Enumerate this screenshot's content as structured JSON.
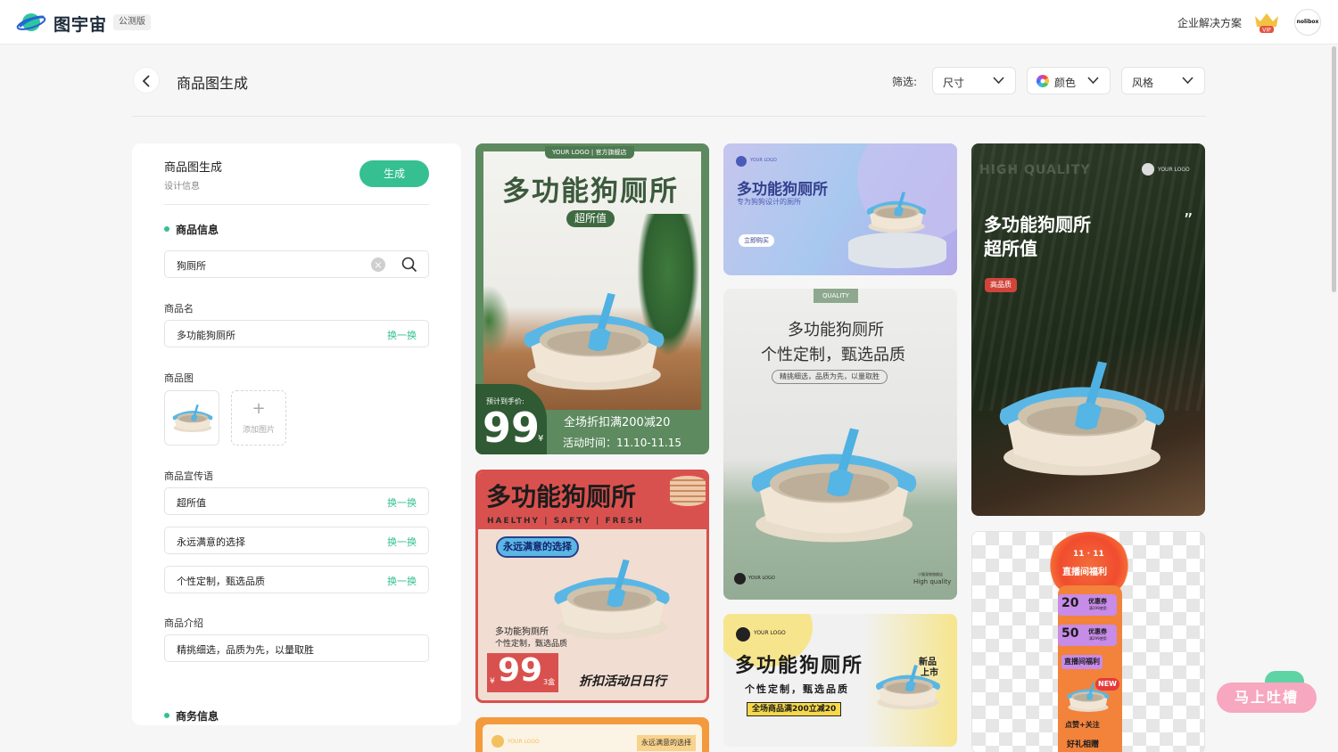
{
  "topbar": {
    "logo_text": "图宇宙",
    "beta_badge": "公测版",
    "enterprise_link": "企业解决方案",
    "vip_label": "VIP",
    "avatar_text": "nolibox"
  },
  "header": {
    "title": "商品图生成",
    "filter_label": "筛选:",
    "filters": [
      {
        "label": "尺寸"
      },
      {
        "label": "颜色"
      },
      {
        "label": "风格"
      }
    ]
  },
  "panel": {
    "title": "商品图生成",
    "subtitle": "设计信息",
    "generate_label": "生成",
    "product_info_heading": "商品信息",
    "search_value": "狗厕所",
    "name_label": "商品名",
    "name_value": "多功能狗厕所",
    "swap_label": "换一换",
    "image_label": "商品图",
    "add_image_label": "添加图片",
    "slogan_label": "商品宣传语",
    "slogans": [
      "超所值",
      "永远满意的选择",
      "个性定制，甄选品质"
    ],
    "intro_label": "商品介绍",
    "intro_value": "精挑细选，品质为先，以量取胜",
    "business_heading": "商务信息"
  },
  "cards": {
    "c1": {
      "badge": "YOUR LOGO | 官方旗舰店",
      "title": "多功能狗厕所",
      "tag": "超所值",
      "price_label": "预计到手价:",
      "price": "99",
      "currency": "¥",
      "promo": "全场折扣满200减20",
      "time": "活动时间：11.10-11.15"
    },
    "c2": {
      "logo": "YOUR LOGO",
      "title": "多功能狗厕所",
      "sub": "专为狗狗设计的厕所",
      "cta": "立即购买"
    },
    "c3": {
      "tag": "QUALITY",
      "title1": "多功能狗厕所",
      "title2": "个性定制，甄选品质",
      "sub": "精挑细选，品质为先，以量取胜",
      "logo": "YOUR LOGO",
      "footer1": "小猫宠物旗舰店",
      "footer2": "High quality"
    },
    "c4": {
      "watermark": "HIGH QUALITY",
      "logo": "YOUR LOGO",
      "title1": "多功能狗厕所",
      "title2": "超所值",
      "badge": "高品质",
      "quote": "”"
    },
    "c5": {
      "title": "多功能狗厕所",
      "tagline": "HAELTHY | SAFTY | FRESH",
      "bubble": "永远满意的选择",
      "desc1": "多功能狗厕所",
      "desc2": "个性定制，甄选品质",
      "currency": "¥",
      "price": "99",
      "unit": "3盒",
      "promo": "折扣活动日日行"
    },
    "c6": {
      "logo": "YOUR LOGO",
      "title": "多功能狗厕所",
      "sub": "个性定制，甄选品质",
      "promo": "全场商品满200立减20",
      "burst1": "新品",
      "burst2": "上市"
    },
    "c7": {
      "date": "11 · 11",
      "banner": "直播间福利",
      "coupon1_amount": "20",
      "coupon1_label": "优惠券",
      "coupon1_note": "满199使用",
      "coupon2_amount": "50",
      "coupon2_label": "优惠券",
      "coupon2_note": "满299使用",
      "banner2": "直播间福利",
      "new_tag": "NEW",
      "follow": "点赞+关注",
      "gift": "好礼相赠"
    },
    "c8": {
      "logo": "YOUR LOGO",
      "badge": "永远满意的选择"
    }
  },
  "feedback": {
    "label": "马上吐槽"
  },
  "colors": {
    "accent": "#36c092",
    "card1_green": "#5b8a5f",
    "card5_red": "#d9514e",
    "card4_dark": "#1f2a1c",
    "product_blue": "#59b8e6"
  }
}
